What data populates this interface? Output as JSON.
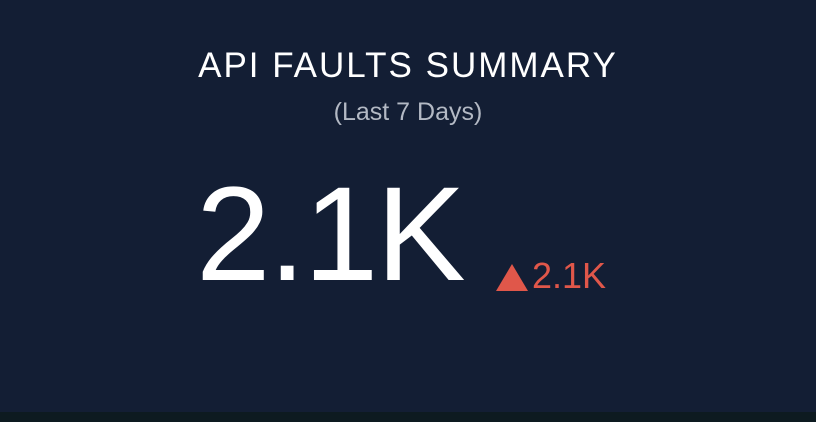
{
  "widget": {
    "title": "API FAULTS SUMMARY",
    "subtitle": "(Last 7 Days)",
    "value": "2.1K",
    "delta": {
      "direction_icon": "triangle-up-icon",
      "value": "2.1K",
      "color": "#e0574a"
    }
  },
  "colors": {
    "background": "#131e34",
    "title": "#ffffff",
    "subtitle": "#b3b9c4",
    "value": "#ffffff"
  }
}
